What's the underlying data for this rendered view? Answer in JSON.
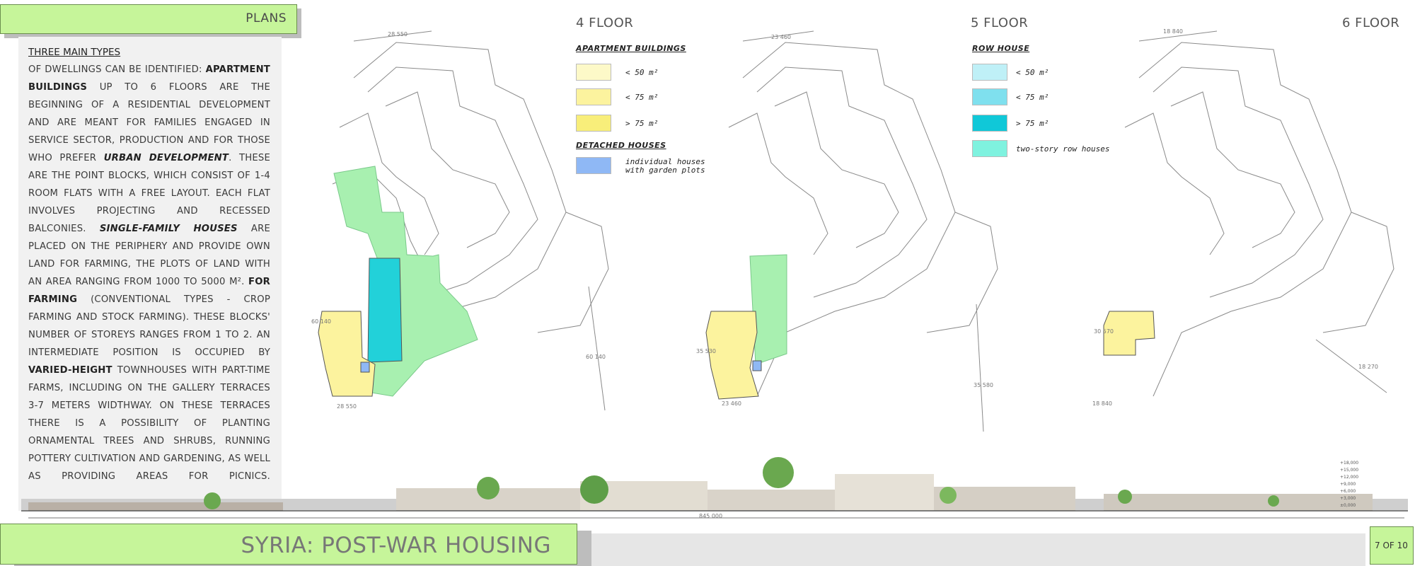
{
  "header": {
    "plans_label": "PLANS"
  },
  "text_panel": {
    "heading": "THREE MAIN TYPES",
    "p1": "OF DWELLINGS CAN BE IDENTIFIED:",
    "apartment_buildings": "APARTMENT BUILDINGS",
    "p2": "UP TO 6 FLOORS ARE THE BEGINNING OF A RESIDENTIAL DEVELOPMENT AND ARE MEANT FOR FAMILIES ENGAGED IN SERVICE SECTOR, PRODUCTION AND FOR THOSE WHO PREFER",
    "urban_development": "URBAN DEVELOPMENT",
    "p3": ". THESE ARE THE POINT BLOCKS, WHICH CONSIST OF 1-4 ROOM FLATS WITH A FREE LAYOUT. EACH FLAT INVOLVES PROJECTING AND RECESSED BALCONIES.",
    "single_family": "SINGLE-FAMILY HOUSES",
    "p4": "ARE PLACED ON THE PERIPHERY AND PROVIDE OWN LAND FOR FARMING, THE PLOTS OF LAND WITH AN AREA RANGING FROM 1000 TO 5000 M². ",
    "for_farming": "FOR FARMING",
    "p5": "(CONVENTIONAL TYPES - CROP FARMING AND STOCK FARMING). THESE BLOCKS' NUMBER OF STOREYS RANGES FROM 1 TO 2. AN INTERMEDIATE POSITION IS OCCUPIED BY",
    "varied_height": "VARIED-HEIGHT",
    "p6": "TOWNHOUSES WITH PART-TIME FARMS, INCLUDING ON THE GALLERY TERRACES 3-7 METERS WIDTHWAY. ON THESE TERRACES THERE IS A POSSIBILITY OF PLANTING ORNAMENTAL TREES AND SHRUBS, RUNNING POTTERY CULTIVATION AND GARDENING, AS WELL AS PROVIDING AREAS FOR PICNICS."
  },
  "floors": {
    "f4": "4 FLOOR",
    "f5": "5 FLOOR",
    "f6": "6 FLOOR"
  },
  "legend_apartments": {
    "heading": "APARTMENT BUILDINGS",
    "items": [
      {
        "label": "< 50 m²",
        "color": "#fdf9c8"
      },
      {
        "label": "< 75 m²",
        "color": "#fcf39e"
      },
      {
        "label": "> 75 m²",
        "color": "#f8ee7a"
      }
    ],
    "detached_heading": "DETACHED HOUSES",
    "detached_label_1": "individual houses",
    "detached_label_2": "with garden plots",
    "detached_color": "#8fb8f5"
  },
  "legend_row": {
    "heading": "ROW HOUSE",
    "items": [
      {
        "label": "< 50 m²",
        "color": "#bff0f7"
      },
      {
        "label": "< 75 m²",
        "color": "#7fe0ee"
      },
      {
        "label": "> 75 m²",
        "color": "#10c8d8"
      },
      {
        "label": "two-story row houses",
        "color": "#7ff2df"
      }
    ]
  },
  "plan_labels": {
    "f4_top": "28 550",
    "f4_bottom": "28 550",
    "f4_side": "60 140",
    "f4_right": "60 140",
    "f5_top": "23 460",
    "f5_bottom": "23 460",
    "f5_side": "35 530",
    "f5_right": "35 580",
    "f6_top": "18 840",
    "f6_bottom": "18 840",
    "f6_side": "30 570",
    "f6_right": "18 270"
  },
  "section": {
    "length": "845 000",
    "levels": [
      "+18,000",
      "+15,000",
      "+12,000",
      "+9,000",
      "+6,000",
      "+3,000",
      "±0,000"
    ]
  },
  "footer": {
    "title": "SYRIA: POST-WAR HOUSING",
    "page": "7 OF 10"
  }
}
